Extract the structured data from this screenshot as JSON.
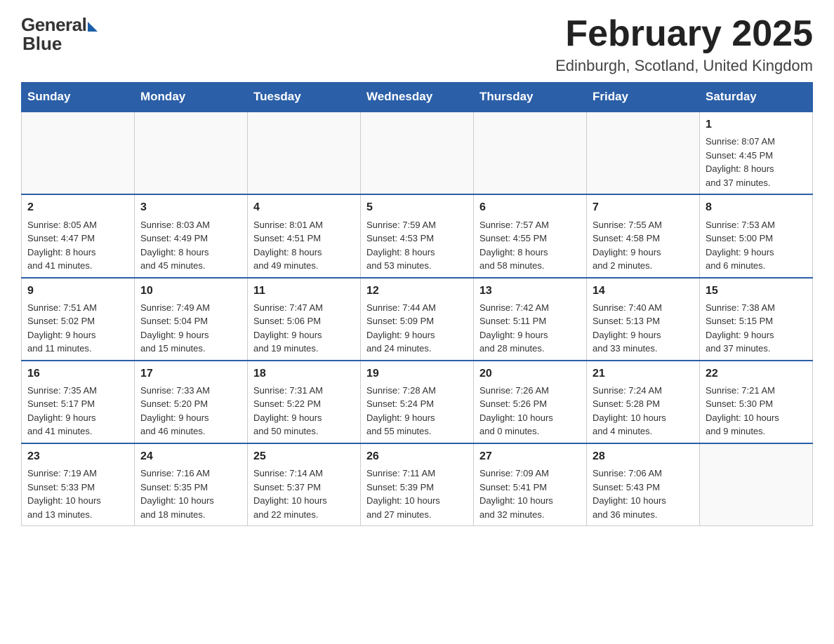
{
  "logo": {
    "general": "General",
    "blue": "Blue"
  },
  "header": {
    "month_title": "February 2025",
    "location": "Edinburgh, Scotland, United Kingdom"
  },
  "days_of_week": [
    "Sunday",
    "Monday",
    "Tuesday",
    "Wednesday",
    "Thursday",
    "Friday",
    "Saturday"
  ],
  "weeks": [
    [
      {
        "day": "",
        "info": ""
      },
      {
        "day": "",
        "info": ""
      },
      {
        "day": "",
        "info": ""
      },
      {
        "day": "",
        "info": ""
      },
      {
        "day": "",
        "info": ""
      },
      {
        "day": "",
        "info": ""
      },
      {
        "day": "1",
        "info": "Sunrise: 8:07 AM\nSunset: 4:45 PM\nDaylight: 8 hours\nand 37 minutes."
      }
    ],
    [
      {
        "day": "2",
        "info": "Sunrise: 8:05 AM\nSunset: 4:47 PM\nDaylight: 8 hours\nand 41 minutes."
      },
      {
        "day": "3",
        "info": "Sunrise: 8:03 AM\nSunset: 4:49 PM\nDaylight: 8 hours\nand 45 minutes."
      },
      {
        "day": "4",
        "info": "Sunrise: 8:01 AM\nSunset: 4:51 PM\nDaylight: 8 hours\nand 49 minutes."
      },
      {
        "day": "5",
        "info": "Sunrise: 7:59 AM\nSunset: 4:53 PM\nDaylight: 8 hours\nand 53 minutes."
      },
      {
        "day": "6",
        "info": "Sunrise: 7:57 AM\nSunset: 4:55 PM\nDaylight: 8 hours\nand 58 minutes."
      },
      {
        "day": "7",
        "info": "Sunrise: 7:55 AM\nSunset: 4:58 PM\nDaylight: 9 hours\nand 2 minutes."
      },
      {
        "day": "8",
        "info": "Sunrise: 7:53 AM\nSunset: 5:00 PM\nDaylight: 9 hours\nand 6 minutes."
      }
    ],
    [
      {
        "day": "9",
        "info": "Sunrise: 7:51 AM\nSunset: 5:02 PM\nDaylight: 9 hours\nand 11 minutes."
      },
      {
        "day": "10",
        "info": "Sunrise: 7:49 AM\nSunset: 5:04 PM\nDaylight: 9 hours\nand 15 minutes."
      },
      {
        "day": "11",
        "info": "Sunrise: 7:47 AM\nSunset: 5:06 PM\nDaylight: 9 hours\nand 19 minutes."
      },
      {
        "day": "12",
        "info": "Sunrise: 7:44 AM\nSunset: 5:09 PM\nDaylight: 9 hours\nand 24 minutes."
      },
      {
        "day": "13",
        "info": "Sunrise: 7:42 AM\nSunset: 5:11 PM\nDaylight: 9 hours\nand 28 minutes."
      },
      {
        "day": "14",
        "info": "Sunrise: 7:40 AM\nSunset: 5:13 PM\nDaylight: 9 hours\nand 33 minutes."
      },
      {
        "day": "15",
        "info": "Sunrise: 7:38 AM\nSunset: 5:15 PM\nDaylight: 9 hours\nand 37 minutes."
      }
    ],
    [
      {
        "day": "16",
        "info": "Sunrise: 7:35 AM\nSunset: 5:17 PM\nDaylight: 9 hours\nand 41 minutes."
      },
      {
        "day": "17",
        "info": "Sunrise: 7:33 AM\nSunset: 5:20 PM\nDaylight: 9 hours\nand 46 minutes."
      },
      {
        "day": "18",
        "info": "Sunrise: 7:31 AM\nSunset: 5:22 PM\nDaylight: 9 hours\nand 50 minutes."
      },
      {
        "day": "19",
        "info": "Sunrise: 7:28 AM\nSunset: 5:24 PM\nDaylight: 9 hours\nand 55 minutes."
      },
      {
        "day": "20",
        "info": "Sunrise: 7:26 AM\nSunset: 5:26 PM\nDaylight: 10 hours\nand 0 minutes."
      },
      {
        "day": "21",
        "info": "Sunrise: 7:24 AM\nSunset: 5:28 PM\nDaylight: 10 hours\nand 4 minutes."
      },
      {
        "day": "22",
        "info": "Sunrise: 7:21 AM\nSunset: 5:30 PM\nDaylight: 10 hours\nand 9 minutes."
      }
    ],
    [
      {
        "day": "23",
        "info": "Sunrise: 7:19 AM\nSunset: 5:33 PM\nDaylight: 10 hours\nand 13 minutes."
      },
      {
        "day": "24",
        "info": "Sunrise: 7:16 AM\nSunset: 5:35 PM\nDaylight: 10 hours\nand 18 minutes."
      },
      {
        "day": "25",
        "info": "Sunrise: 7:14 AM\nSunset: 5:37 PM\nDaylight: 10 hours\nand 22 minutes."
      },
      {
        "day": "26",
        "info": "Sunrise: 7:11 AM\nSunset: 5:39 PM\nDaylight: 10 hours\nand 27 minutes."
      },
      {
        "day": "27",
        "info": "Sunrise: 7:09 AM\nSunset: 5:41 PM\nDaylight: 10 hours\nand 32 minutes."
      },
      {
        "day": "28",
        "info": "Sunrise: 7:06 AM\nSunset: 5:43 PM\nDaylight: 10 hours\nand 36 minutes."
      },
      {
        "day": "",
        "info": ""
      }
    ]
  ]
}
